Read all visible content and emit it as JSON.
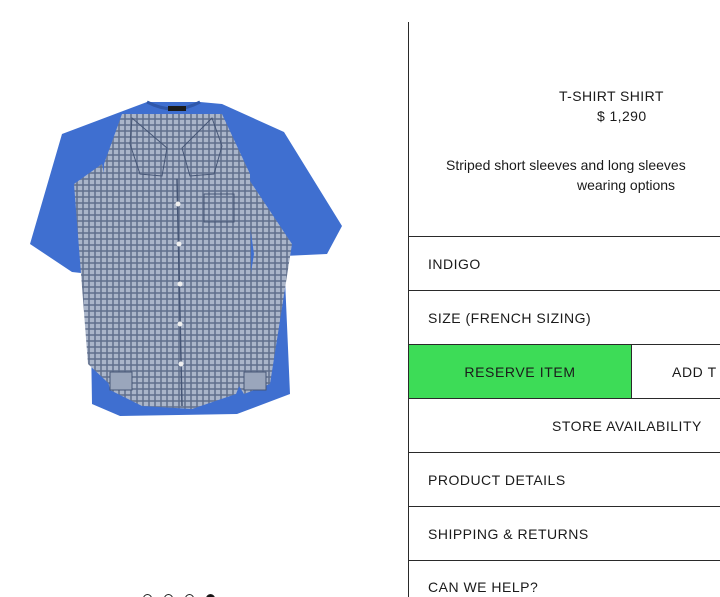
{
  "product": {
    "title": "T-SHIRT SHIRT",
    "price": "$ 1,290",
    "description_line1": "Striped short sleeves and long sleeves",
    "description_line2": "wearing options"
  },
  "options": {
    "color": "INDIGO",
    "size": "SIZE (FRENCH SIZING)"
  },
  "actions": {
    "reserve_label": "RESERVE ITEM",
    "add_label": "ADD T",
    "store_availability_label": "STORE AVAILABILITY"
  },
  "accordion": {
    "product_details": "PRODUCT DETAILS",
    "shipping_returns": "SHIPPING & RETURNS",
    "help": "CAN WE HELP?"
  },
  "gallery": {
    "image_count": 4,
    "active_index": 4,
    "image_subject": "plaid shirt over blue t-shirt"
  },
  "colors": {
    "reserve_button_bg": "#3ddc57",
    "shirt_blue": "#3f6fd0",
    "check_fabric": "#8e9cb6"
  }
}
